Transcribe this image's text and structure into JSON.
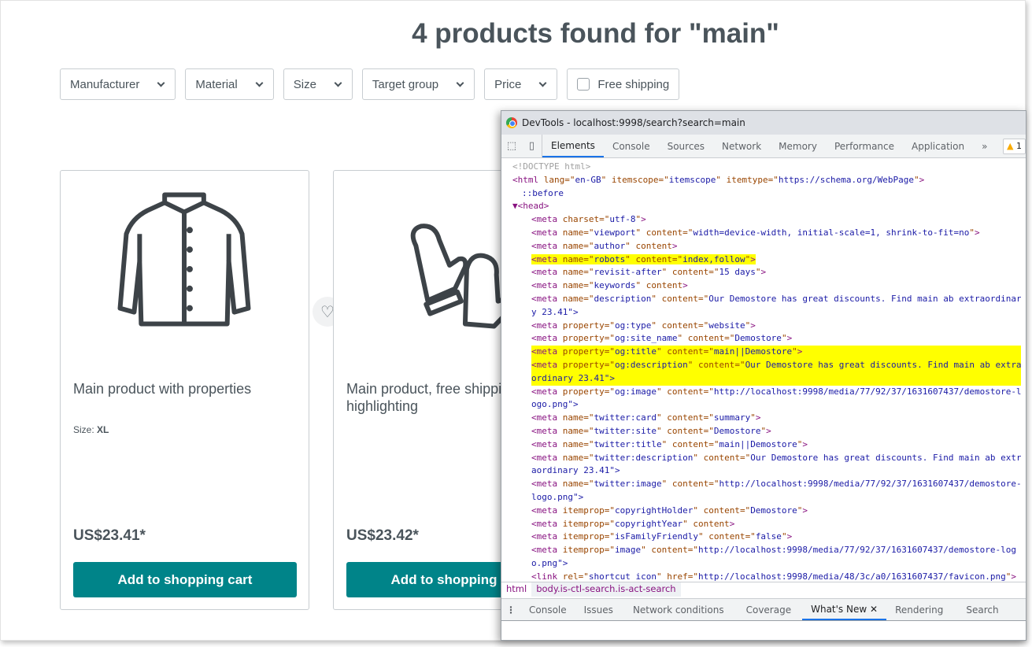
{
  "page": {
    "heading": "4 products found for \"main\"",
    "filters": [
      "Manufacturer",
      "Material",
      "Size",
      "Target group",
      "Price"
    ],
    "free_shipping_label": "Free shipping",
    "accent_color": "#008489",
    "products": [
      {
        "title": "Main product with properties",
        "prop_label": "Size:",
        "prop_value": "XL",
        "price": "US$23.41*",
        "button": "Add to shopping cart",
        "image_icon": "jacket-icon"
      },
      {
        "title": "Main product, free shipping with highlighting",
        "price": "US$23.42*",
        "button": "Add to shopping cart",
        "image_icon": "mittens-icon"
      }
    ]
  },
  "devtools": {
    "window_title": "DevTools - localhost:9998/search?search=main",
    "tabs": [
      "Elements",
      "Console",
      "Sources",
      "Network",
      "Memory",
      "Performance",
      "Application"
    ],
    "active_tab": "Elements",
    "warning_count": "1",
    "lines": [
      {
        "text": "<!DOCTYPE html>",
        "indent": 0,
        "kind": "gray"
      },
      {
        "text": "<html lang=\"en-GB\" itemscope=\"itemscope\" itemtype=\"https://schema.org/WebPage\">",
        "indent": 0
      },
      {
        "text": "::before",
        "indent": 1,
        "kind": "pseudo"
      },
      {
        "text": "▼<head>",
        "indent": 0
      },
      {
        "text": "<meta charset=\"utf-8\">",
        "indent": 2
      },
      {
        "text": "<meta name=\"viewport\" content=\"width=device-width, initial-scale=1, shrink-to-fit=no\">",
        "indent": 2
      },
      {
        "text": "<meta name=\"author\" content>",
        "indent": 2
      },
      {
        "text": "<meta name=\"robots\" content=\"index,follow\">",
        "indent": 2,
        "highlight": true
      },
      {
        "text": "<meta name=\"revisit-after\" content=\"15 days\">",
        "indent": 2
      },
      {
        "text": "<meta name=\"keywords\" content>",
        "indent": 2
      },
      {
        "text": "<meta name=\"description\" content=\"Our Demostore has great discounts. Find main ab extraordinar",
        "indent": 2
      },
      {
        "text": "y 23.41\">",
        "indent": 2,
        "cont": true
      },
      {
        "text": "<meta property=\"og:type\" content=\"website\">",
        "indent": 2
      },
      {
        "text": "<meta property=\"og:site_name\" content=\"Demostore\">",
        "indent": 2
      },
      {
        "text": "<meta property=\"og:title\" content=\"main||Demostore\">",
        "indent": 2,
        "highlight": true,
        "full": true
      },
      {
        "text": "<meta property=\"og:description\" content=\"Our Demostore has great discounts. Find main ab extra",
        "indent": 2,
        "highlight": true,
        "full": true
      },
      {
        "text": "ordinary 23.41\">",
        "indent": 2,
        "cont": true,
        "highlight": true,
        "full": true
      },
      {
        "text": "<meta property=\"og:image\" content=\"http://localhost:9998/media/77/92/37/1631607437/demostore-l",
        "indent": 2
      },
      {
        "text": "ogo.png\">",
        "indent": 2,
        "cont": true
      },
      {
        "text": "<meta name=\"twitter:card\" content=\"summary\">",
        "indent": 2
      },
      {
        "text": "<meta name=\"twitter:site\" content=\"Demostore\">",
        "indent": 2
      },
      {
        "text": "<meta name=\"twitter:title\" content=\"main||Demostore\">",
        "indent": 2
      },
      {
        "text": "<meta name=\"twitter:description\" content=\"Our Demostore has great discounts. Find main ab extr",
        "indent": 2
      },
      {
        "text": "aordinary 23.41\">",
        "indent": 2,
        "cont": true
      },
      {
        "text": "<meta name=\"twitter:image\" content=\"http://localhost:9998/media/77/92/37/1631607437/demostore-",
        "indent": 2
      },
      {
        "text": "logo.png\">",
        "indent": 2,
        "cont": true
      },
      {
        "text": "<meta itemprop=\"copyrightHolder\" content=\"Demostore\">",
        "indent": 2
      },
      {
        "text": "<meta itemprop=\"copyrightYear\" content>",
        "indent": 2
      },
      {
        "text": "<meta itemprop=\"isFamilyFriendly\" content=\"false\">",
        "indent": 2
      },
      {
        "text": "<meta itemprop=\"image\" content=\"http://localhost:9998/media/77/92/37/1631607437/demostore-log",
        "indent": 2
      },
      {
        "text": "o.png\">",
        "indent": 2,
        "cont": true
      },
      {
        "text": "<link rel=\"shortcut icon\" href=\"http://localhost:9998/media/48/3c/a0/1631607437/favicon.png\">",
        "indent": 2
      }
    ],
    "breadcrumbs": [
      "html",
      "body.is-ctl-search.is-act-search"
    ],
    "drawer_tabs": [
      "Console",
      "Issues",
      "Network conditions",
      "Coverage",
      "What's New",
      "Rendering",
      "Search"
    ],
    "active_drawer_tab": "What's New",
    "highlight_color": "#ffff00"
  }
}
